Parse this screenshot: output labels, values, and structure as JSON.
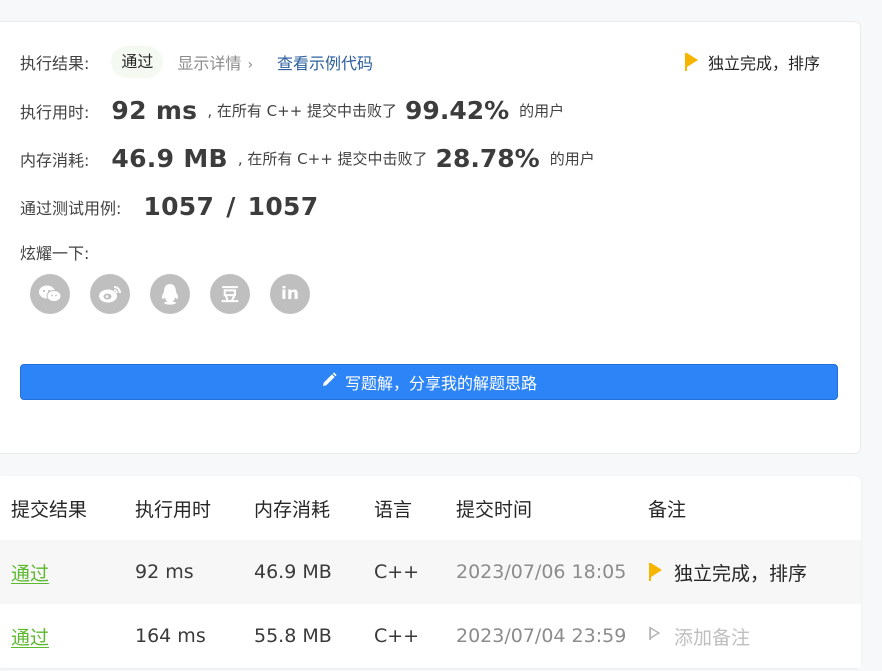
{
  "result": {
    "label": "执行结果:",
    "status": "通过",
    "details_link": "显示详情",
    "details_chevron": "›",
    "example_link": "查看示例代码",
    "note": "独立完成，排序"
  },
  "runtime": {
    "label": "执行用时:",
    "value": "92",
    "unit": "ms",
    "beat_text": ", 在所有 C++ 提交中击败了",
    "percent": "99.42%",
    "suffix": "的用户"
  },
  "memory": {
    "label": "内存消耗:",
    "value": "46.9",
    "unit": "MB",
    "beat_text": ", 在所有 C++ 提交中击败了",
    "percent": "28.78%",
    "suffix": "的用户"
  },
  "testcases": {
    "label": "通过测试用例:",
    "passed": "1057",
    "separator": "/",
    "total": "1057"
  },
  "share": {
    "label": "炫耀一下:",
    "icons": [
      "wechat-icon",
      "weibo-icon",
      "qq-icon",
      "douban-icon",
      "linkedin-icon"
    ],
    "douban_glyph": "豆",
    "linkedin_glyph": "in"
  },
  "write_solution": {
    "label": "写题解，分享我的解题思路"
  },
  "colors": {
    "primary": "#2d84f7",
    "success": "#5cb82f",
    "flag": "#f7b500",
    "muted": "#8c8c8c"
  },
  "submissions": {
    "headers": [
      "提交结果",
      "执行用时",
      "内存消耗",
      "语言",
      "提交时间",
      "备注"
    ],
    "rows": [
      {
        "status": "通过",
        "runtime": "92 ms",
        "memory": "46.9 MB",
        "language": "C++",
        "time": "2023/07/06 18:05",
        "note": "独立完成，排序"
      },
      {
        "status": "通过",
        "runtime": "164 ms",
        "memory": "55.8 MB",
        "language": "C++",
        "time": "2023/07/04 23:59",
        "note": "添加备注"
      }
    ]
  }
}
